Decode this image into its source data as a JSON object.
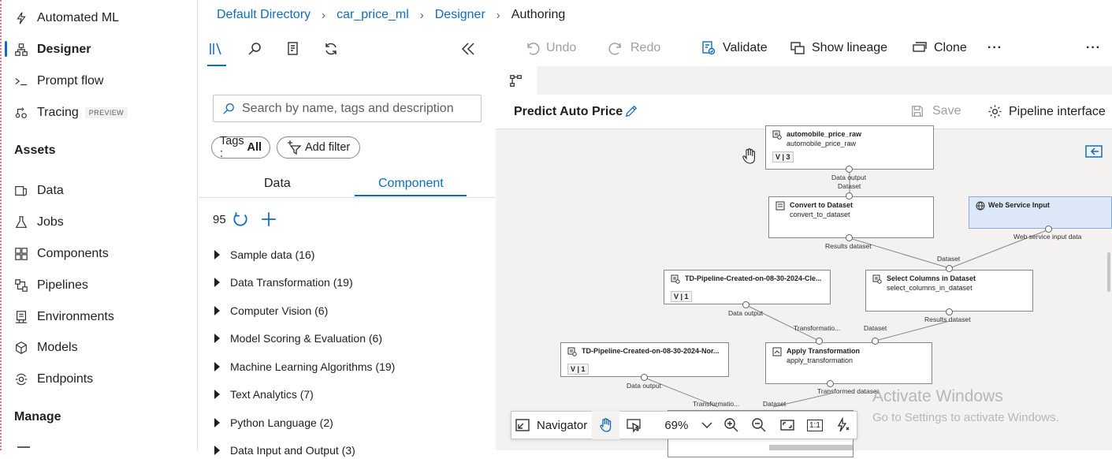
{
  "nav": {
    "items_top": [
      {
        "label": "Automated ML",
        "icon": "automated-ml-icon"
      },
      {
        "label": "Designer",
        "icon": "designer-icon",
        "active": true
      },
      {
        "label": "Prompt flow",
        "icon": "prompt-flow-icon"
      },
      {
        "label": "Tracing",
        "icon": "tracing-icon",
        "badge": "PREVIEW"
      }
    ],
    "assets_heading": "Assets",
    "assets": [
      {
        "label": "Data",
        "icon": "data-icon"
      },
      {
        "label": "Jobs",
        "icon": "jobs-icon"
      },
      {
        "label": "Components",
        "icon": "components-icon"
      },
      {
        "label": "Pipelines",
        "icon": "pipelines-icon"
      },
      {
        "label": "Environments",
        "icon": "environments-icon"
      },
      {
        "label": "Models",
        "icon": "models-icon"
      },
      {
        "label": "Endpoints",
        "icon": "endpoints-icon"
      }
    ],
    "manage_heading": "Manage"
  },
  "breadcrumb": {
    "items": [
      "Default Directory",
      "car_price_ml",
      "Designer"
    ],
    "current": "Authoring"
  },
  "library": {
    "search_placeholder": "Search by name, tags and description",
    "tags_label": "Tags : ",
    "tags_value": "All",
    "add_filter": "Add filter",
    "tabs": [
      "Data",
      "Component"
    ],
    "active_tab": "Component",
    "count": "95",
    "categories": [
      "Sample data (16)",
      "Data Transformation (19)",
      "Computer Vision (6)",
      "Model Scoring & Evaluation (6)",
      "Machine Learning Algorithms (19)",
      "Text Analytics (7)",
      "Python Language (2)",
      "Data Input and Output (3)"
    ]
  },
  "toolbar": {
    "undo": "Undo",
    "redo": "Redo",
    "validate": "Validate",
    "show_lineage": "Show lineage",
    "clone": "Clone",
    "more": "···"
  },
  "pipeline": {
    "title": "Predict Auto Price",
    "save": "Save",
    "interface": "Pipeline interface"
  },
  "graph": {
    "nodes": {
      "auto": {
        "title": "automobile_price_raw",
        "sub": "automobile_price_raw",
        "version": "V | 3"
      },
      "convert": {
        "title": "Convert to Dataset",
        "sub": "convert_to_dataset"
      },
      "wsinput": {
        "title": "Web Service Input"
      },
      "td1": {
        "title": "TD-Pipeline-Created-on-08-30-2024-Cle...",
        "version": "V | 1"
      },
      "select": {
        "title": "Select Columns in Dataset",
        "sub": "select_columns_in_dataset"
      },
      "td2": {
        "title": "TD-Pipeline-Created-on-08-30-2024-Nor...",
        "version": "V | 1"
      },
      "apply": {
        "title": "Apply Transformation",
        "sub": "apply_transformation"
      }
    },
    "ports": {
      "data_output_1": "Data output",
      "dataset_1": "Dataset",
      "results_dataset_1": "Results dataset",
      "ws_input_data": "Web service input data",
      "dataset_2": "Dataset",
      "data_output_2": "Data output",
      "transformation_1": "Transformatio...",
      "dataset_3": "Dataset",
      "results_dataset_2": "Results dataset",
      "data_output_3": "Data output",
      "transformed_dataset": "Transformed dataset",
      "transformation_2": "Transformatio...",
      "dataset_4": "Dataset"
    }
  },
  "navigator": {
    "label": "Navigator",
    "zoom": "69%",
    "actual_size": "1:1"
  },
  "watermark": {
    "title": "Activate Windows",
    "subtitle": "Go to Settings to activate Windows."
  },
  "colors": {
    "accent": "#0f6cbd",
    "canvas": "#f3f2f1",
    "ws_node": "#dce8f7"
  }
}
